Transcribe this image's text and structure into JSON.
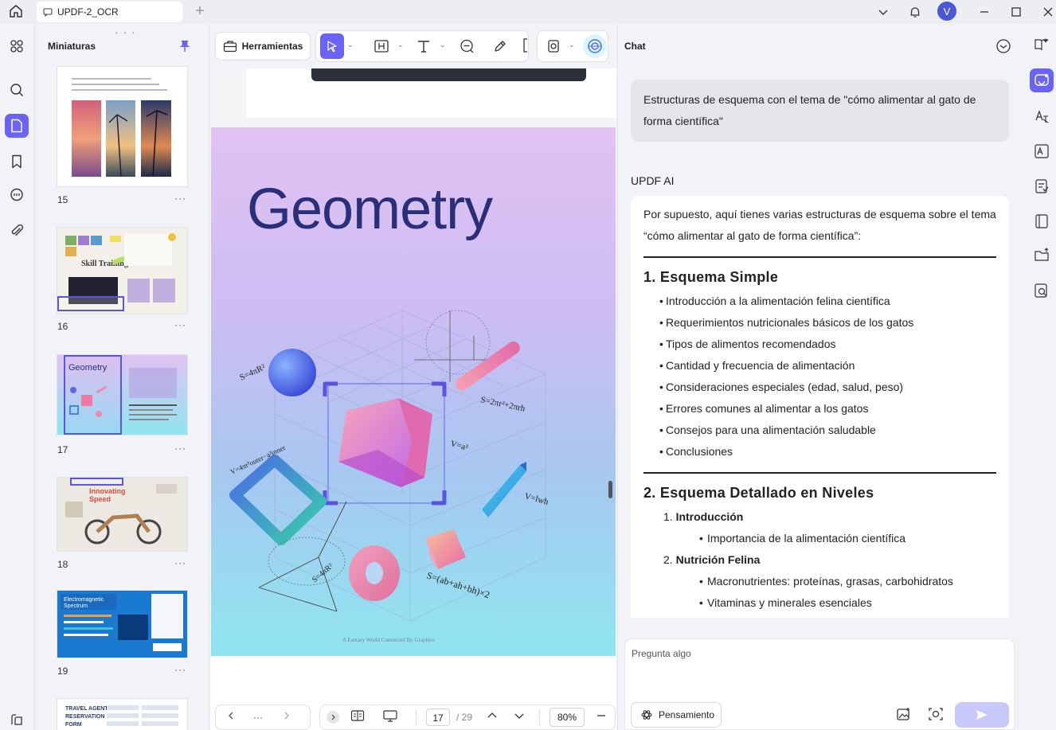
{
  "titlebar": {
    "tab_title": "UPDF-2_OCR",
    "avatar_letter": "V"
  },
  "thumbnails": {
    "panel_title": "Miniaturas",
    "pages": [
      {
        "num": "15",
        "more": "···"
      },
      {
        "num": "16",
        "more": "···"
      },
      {
        "num": "17",
        "more": "···",
        "label": "Geometry"
      },
      {
        "num": "18",
        "more": "···"
      },
      {
        "num": "19",
        "more": "···"
      }
    ]
  },
  "toolbar": {
    "tools_label": "Herramientas"
  },
  "document": {
    "page_title": "Geometry",
    "footer": "A Fantasy World Connected By Graphics",
    "formulas": [
      "S=4πR²",
      "S=2πr²+2πrh",
      "V=a³",
      "V=lwh",
      "S=4πR²",
      "S=(ab+ah+bh)×2",
      "V=4πr³outer−a³inner"
    ]
  },
  "pagenav": {
    "current_page": "17",
    "total_pages": "/ 29",
    "zoom": "80%",
    "more": "···"
  },
  "chat": {
    "title": "Chat",
    "user_message": "Estructuras de esquema con el tema de \"cómo alimentar al gato de forma científica\"",
    "ai_label": "UPDF AI",
    "ai_intro": "Por supuesto, aquí tienes varias estructuras de esquema sobre el tema “cómo alimentar al gato de forma científica”:",
    "section1_title": "1. Esquema Simple",
    "section1_items": [
      "Introducción a la alimentación felina científica",
      "Requerimientos nutricionales básicos de los gatos",
      "Tipos de alimentos recomendados",
      "Cantidad y frecuencia de alimentación",
      "Consideraciones especiales (edad, salud, peso)",
      "Errores comunes al alimentar a los gatos",
      "Consejos para una alimentación saludable",
      "Conclusiones"
    ],
    "section2_title": "2. Esquema Detallado en Niveles",
    "section2_sub1_num": "1.",
    "section2_sub1": "Introducción",
    "section2_sub1_items": [
      "Importancia de la alimentación científica"
    ],
    "section2_sub2_num": "2.",
    "section2_sub2": "Nutrición Felina",
    "section2_sub2_items": [
      "Macronutrientes: proteínas, grasas, carbohidratos",
      "Vitaminas y minerales esenciales"
    ],
    "input_placeholder": "Pregunta algo",
    "think_label": "Pensamiento"
  },
  "colors": {
    "accent": "#6b63f5",
    "title_navy": "#2b2f7a"
  }
}
